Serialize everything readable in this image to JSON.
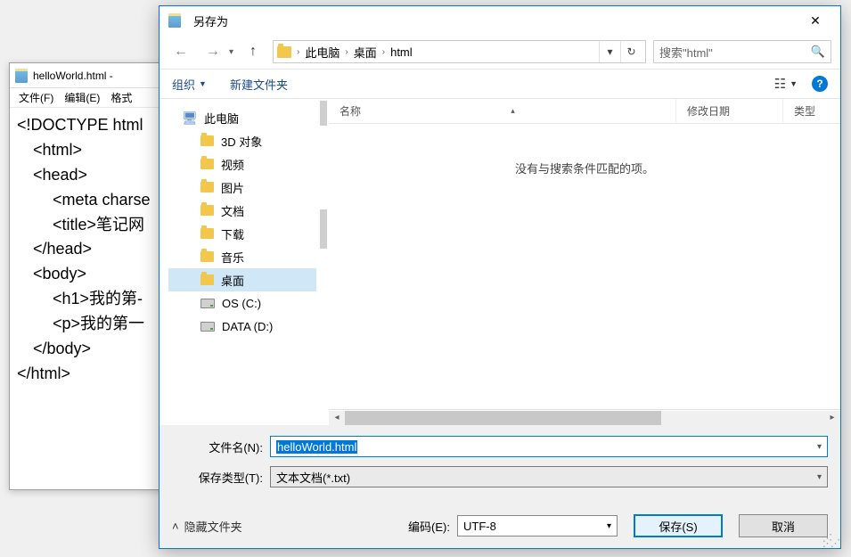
{
  "notepad": {
    "title": "helloWorld.html -",
    "menus": [
      "文件(F)",
      "编辑(E)",
      "格式"
    ],
    "lines": [
      {
        "text": "<!DOCTYPE html",
        "indent": 0
      },
      {
        "text": "<html>",
        "indent": 1
      },
      {
        "text": "<head>",
        "indent": 1
      },
      {
        "text": "<meta charse",
        "indent": 2
      },
      {
        "text": "<title>笔记网",
        "indent": 2
      },
      {
        "text": "</head>",
        "indent": 1
      },
      {
        "text": "<body>",
        "indent": 1
      },
      {
        "text": "<h1>我的第-",
        "indent": 2
      },
      {
        "text": "<p>我的第一",
        "indent": 2
      },
      {
        "text": "</body>",
        "indent": 1
      },
      {
        "text": "</html>",
        "indent": 0
      }
    ]
  },
  "dialog": {
    "title": "另存为",
    "breadcrumbs": [
      "此电脑",
      "桌面",
      "html"
    ],
    "search_placeholder": "搜索\"html\"",
    "organize": "组织",
    "new_folder": "新建文件夹",
    "columns": {
      "name": "名称",
      "date": "修改日期",
      "type": "类型"
    },
    "empty_msg": "没有与搜索条件匹配的项。",
    "tree": [
      {
        "label": "此电脑",
        "icon": "pc",
        "level": 1
      },
      {
        "label": "3D 对象",
        "icon": "folder",
        "level": 2
      },
      {
        "label": "视频",
        "icon": "folder",
        "level": 2
      },
      {
        "label": "图片",
        "icon": "folder",
        "level": 2
      },
      {
        "label": "文档",
        "icon": "folder",
        "level": 2
      },
      {
        "label": "下载",
        "icon": "folder",
        "level": 2
      },
      {
        "label": "音乐",
        "icon": "folder",
        "level": 2
      },
      {
        "label": "桌面",
        "icon": "folder",
        "level": 2,
        "selected": true
      },
      {
        "label": "OS (C:)",
        "icon": "drive",
        "level": 2
      },
      {
        "label": "DATA (D:)",
        "icon": "drive",
        "level": 2
      }
    ],
    "filename_label": "文件名(N):",
    "filename_value": "helloWorld.html",
    "filetype_label": "保存类型(T):",
    "filetype_value": "文本文档(*.txt)",
    "hide_folders": "隐藏文件夹",
    "encoding_label": "编码(E):",
    "encoding_value": "UTF-8",
    "save_btn": "保存(S)",
    "cancel_btn": "取消"
  }
}
